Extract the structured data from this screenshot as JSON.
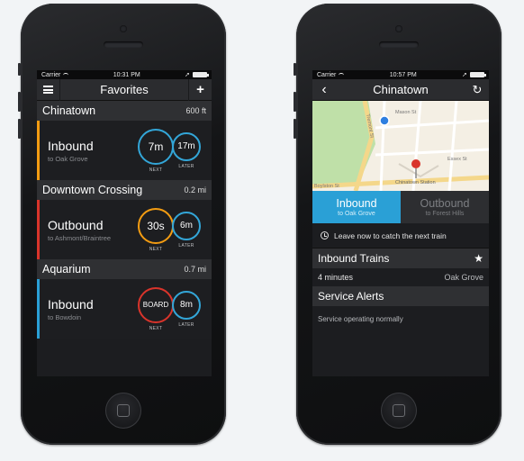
{
  "left_phone": {
    "status": {
      "carrier": "Carrier",
      "time": "10:31 PM"
    },
    "nav": {
      "title": "Favorites",
      "right_icon": "+"
    },
    "stations": [
      {
        "name": "Chinatown",
        "distance": "600 ft",
        "direction": "Inbound",
        "destination": "to Oak Grove",
        "next": "7m",
        "later": "17m",
        "next_label": "NEXT",
        "later_label": "LATER"
      },
      {
        "name": "Downtown Crossing",
        "distance": "0.2 mi",
        "direction": "Outbound",
        "destination": "to Ashmont/Braintree",
        "next": "30s",
        "later": "6m",
        "next_label": "NEXT",
        "later_label": "LATER"
      },
      {
        "name": "Aquarium",
        "distance": "0.7 mi",
        "direction": "Inbound",
        "destination": "to Bowdoin",
        "next": "BOARD",
        "later": "8m",
        "next_label": "NEXT",
        "later_label": "LATER"
      }
    ]
  },
  "right_phone": {
    "status": {
      "carrier": "Carrier",
      "time": "10:57 PM"
    },
    "nav": {
      "title": "Chinatown"
    },
    "map": {
      "labels": {
        "s1": "Mason St",
        "s2": "Tremont St",
        "s3": "Chinatown Station",
        "s4": "Boylston St",
        "s5": "Essex St"
      }
    },
    "segments": {
      "inbound": {
        "label": "Inbound",
        "sub": "to Oak Grove"
      },
      "outbound": {
        "label": "Outbound",
        "sub": "to Forest Hills"
      }
    },
    "leave_text": "Leave now to catch the next train",
    "trains_header": "Inbound Trains",
    "train_row": {
      "time": "4 minutes",
      "dest": "Oak Grove"
    },
    "alerts_header": "Service Alerts",
    "alert_text": "Service operating normally"
  },
  "colors": {
    "orange": "#f39c12",
    "red": "#d9342b",
    "blue": "#2aa0d6"
  }
}
